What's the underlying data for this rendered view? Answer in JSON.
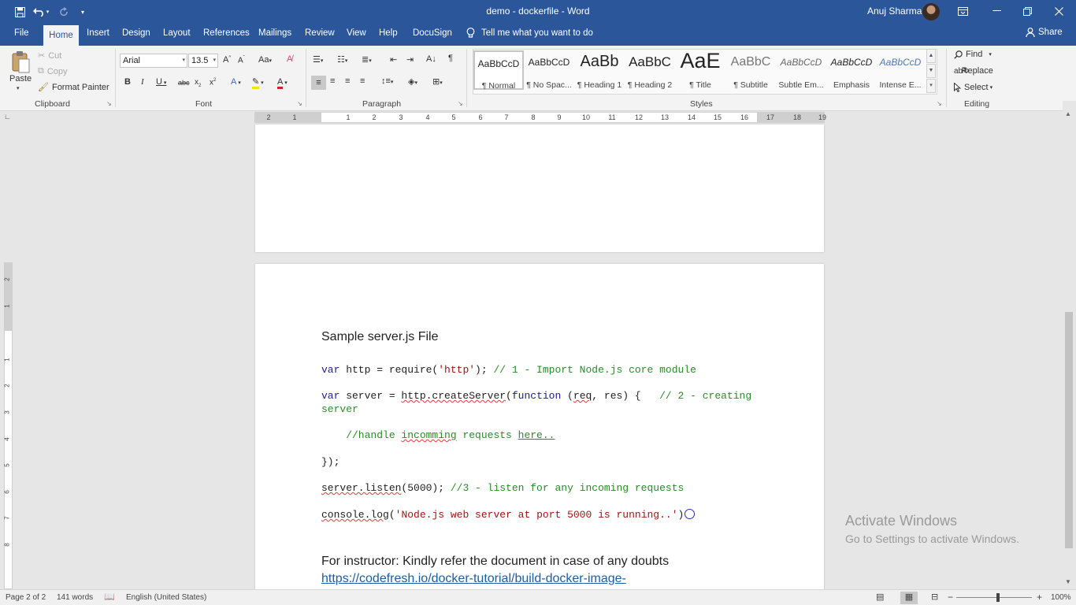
{
  "window": {
    "title": "demo - dockerfile - Word",
    "user_name": "Anuj Sharma"
  },
  "quick_access": {
    "save_icon": "save-icon",
    "undo_icon": "undo-icon",
    "redo_icon": "redo-icon",
    "customize_icon": "customize-icon"
  },
  "menu": {
    "tabs": [
      "File",
      "Home",
      "Insert",
      "Design",
      "Layout",
      "References",
      "Mailings",
      "Review",
      "View",
      "Help",
      "DocuSign"
    ],
    "tell_me": "Tell me what you want to do",
    "share": "Share"
  },
  "ribbon": {
    "clipboard": {
      "paste": "Paste",
      "cut": "Cut",
      "copy": "Copy",
      "format_painter": "Format Painter",
      "label": "Clipboard"
    },
    "font": {
      "family": "Arial",
      "size": "13.5",
      "label": "Font"
    },
    "paragraph": {
      "label": "Paragraph"
    },
    "styles": {
      "label": "Styles",
      "items": [
        {
          "sample": "AaBbCcD",
          "name": "¶ Normal"
        },
        {
          "sample": "AaBbCcD",
          "name": "¶ No Spac..."
        },
        {
          "sample": "AaBb",
          "name": "¶ Heading 1"
        },
        {
          "sample": "AaBbC",
          "name": "¶ Heading 2"
        },
        {
          "sample": "AaE",
          "name": "¶ Title"
        },
        {
          "sample": "AaBbC",
          "name": "¶ Subtitle"
        },
        {
          "sample": "AaBbCcD",
          "name": "Subtle Em..."
        },
        {
          "sample": "AaBbCcD",
          "name": "Emphasis"
        },
        {
          "sample": "AaBbCcD",
          "name": "Intense E..."
        }
      ]
    },
    "editing": {
      "find": "Find",
      "replace": "Replace",
      "select": "Select",
      "label": "Editing"
    }
  },
  "ruler": {
    "numbers": [
      "2",
      "1",
      "1",
      "2",
      "3",
      "4",
      "5",
      "6",
      "7",
      "8",
      "9",
      "10",
      "11",
      "12",
      "13",
      "14",
      "15",
      "16",
      "17",
      "18",
      "19"
    ],
    "vertical_numbers": [
      "2",
      "1",
      "1",
      "2",
      "3",
      "4",
      "5",
      "6",
      "7",
      "8"
    ]
  },
  "document": {
    "heading": "Sample server.js File",
    "line1_kw": "var",
    "line1_a": " http = require(",
    "line1_str": "'http'",
    "line1_b": "); ",
    "line1_cmt": "// 1 - Import Node.js core module",
    "line2_kw": "var",
    "line2_a": " server = ",
    "line2_u": "http.createServer",
    "line2_b": "(",
    "line2_kw2": "function",
    "line2_c": " (",
    "line2_u2": "req",
    "line2_d": ", res) {   ",
    "line2_cmt": "// 2 - creating",
    "line2_cont": "server",
    "line3_a": "    //handle ",
    "line3_u": "incomming",
    "line3_b": " requests ",
    "line3_u2": "here..",
    "line4": "});",
    "line5_u": "server.listen",
    "line5_a": "(5000); ",
    "line5_cmt": "//3 - listen for any incoming requests",
    "line6_u": "console.log",
    "line6_a": "(",
    "line6_str": "'Node.js web server at port 5000 is running..'",
    "line6_b": ")",
    "note": "For instructor: Kindly refer the document in case of any doubts",
    "link": "https://codefresh.io/docker-tutorial/build-docker-image-"
  },
  "watermark": {
    "title": "Activate Windows",
    "subtitle": "Go to Settings to activate Windows."
  },
  "status": {
    "page": "Page 2 of 2",
    "words": "141 words",
    "language": "English (United States)",
    "zoom": "100%"
  }
}
